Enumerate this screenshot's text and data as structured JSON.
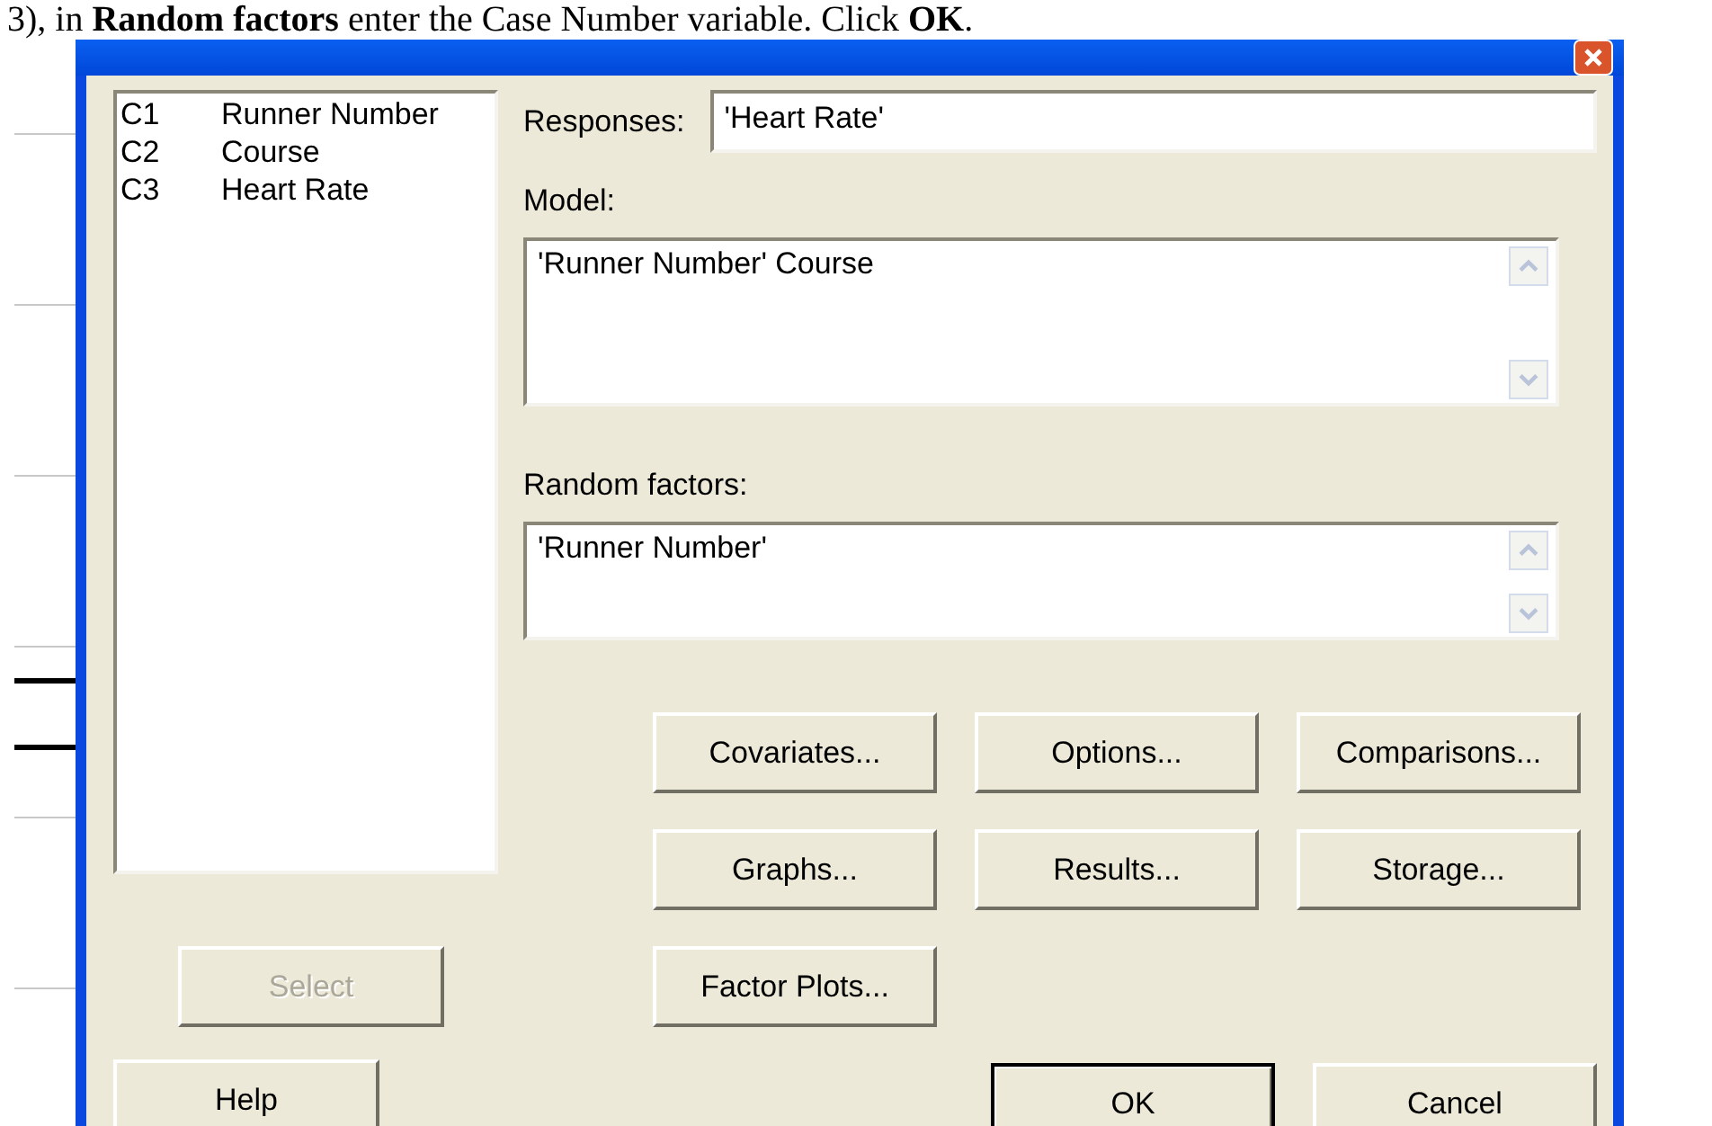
{
  "instruction": "3),  in **Random factors** enter the Case Number variable. Click **OK**.",
  "dialog": {
    "variables": [
      {
        "column": "C1",
        "name": "Runner Number"
      },
      {
        "column": "C2",
        "name": "Course"
      },
      {
        "column": "C3",
        "name": "Heart Rate"
      }
    ],
    "select_button": {
      "label": "Select",
      "disabled": true
    },
    "help_button": {
      "label": "Help"
    },
    "responses": {
      "label": "Responses:",
      "value": "'Heart Rate'"
    },
    "model": {
      "label": "Model:",
      "value": "'Runner Number' Course"
    },
    "random_factors": {
      "label": "Random factors:",
      "value": "'Runner Number'"
    },
    "option_buttons": [
      {
        "label": "Covariates..."
      },
      {
        "label": "Options..."
      },
      {
        "label": "Comparisons..."
      },
      {
        "label": "Graphs..."
      },
      {
        "label": "Results..."
      },
      {
        "label": "Storage..."
      },
      {
        "label": "Factor Plots..."
      }
    ],
    "action_buttons": [
      {
        "label": "OK",
        "default": true
      },
      {
        "label": "Cancel",
        "default": false
      }
    ]
  }
}
